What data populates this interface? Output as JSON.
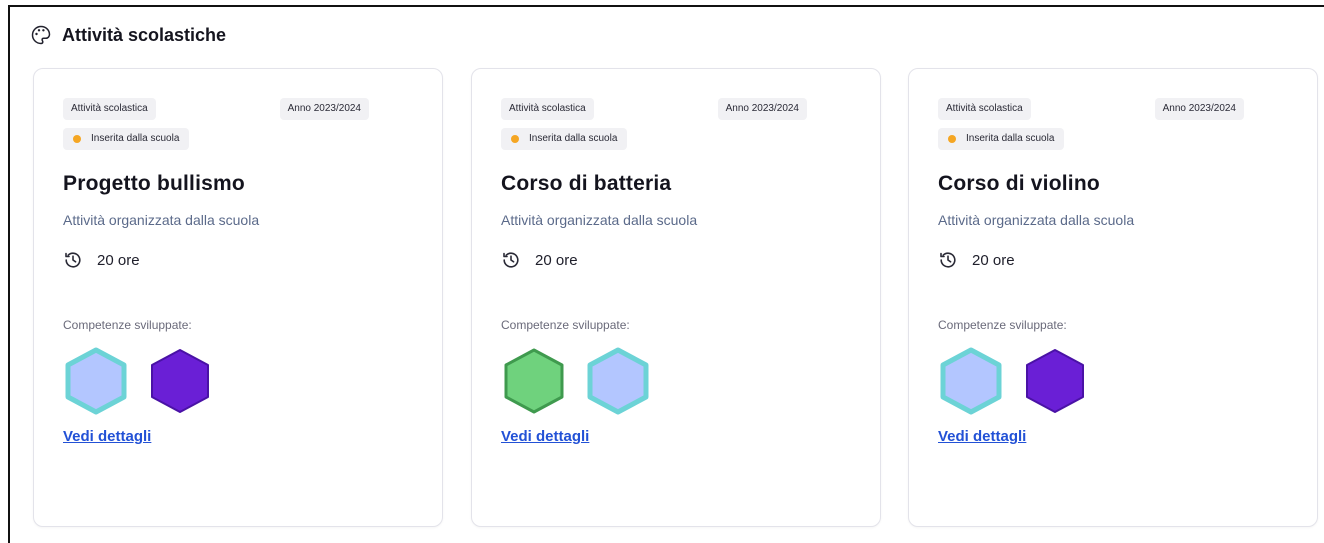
{
  "section": {
    "title": "Attività scolastiche",
    "icon": "palette-icon"
  },
  "cards": [
    {
      "type_tag": "Attività scolastica",
      "year_tag": "Anno 2023/2024",
      "status": "Inserita dalla scuola",
      "status_color": "#f5a623",
      "title": "Progetto bullismo",
      "subtitle": "Attività organizzata dalla scuola",
      "hours": "20 ore",
      "skills_label": "Competenze sviluppate:",
      "skills": [
        {
          "name": "skill-hexagon-light-blue",
          "fill": "#b3c6ff",
          "border": "#6cd3d6"
        },
        {
          "name": "skill-hexagon-purple",
          "fill": "#6a1fd6",
          "border": "#4a12a6"
        }
      ],
      "link": "Vedi dettagli"
    },
    {
      "type_tag": "Attività scolastica",
      "year_tag": "Anno 2023/2024",
      "status": "Inserita dalla scuola",
      "status_color": "#f5a623",
      "title": "Corso di batteria",
      "subtitle": "Attività organizzata dalla scuola",
      "hours": "20 ore",
      "skills_label": "Competenze sviluppate:",
      "skills": [
        {
          "name": "skill-hexagon-green",
          "fill": "#6fd27d",
          "border": "#3f9a4e"
        },
        {
          "name": "skill-hexagon-light-blue",
          "fill": "#b3c6ff",
          "border": "#6cd3d6"
        }
      ],
      "link": "Vedi dettagli"
    },
    {
      "type_tag": "Attività scolastica",
      "year_tag": "Anno 2023/2024",
      "status": "Inserita dalla scuola",
      "status_color": "#f5a623",
      "title": "Corso di violino",
      "subtitle": "Attività organizzata dalla scuola",
      "hours": "20 ore",
      "skills_label": "Competenze sviluppate:",
      "skills": [
        {
          "name": "skill-hexagon-light-blue",
          "fill": "#b3c6ff",
          "border": "#6cd3d6"
        },
        {
          "name": "skill-hexagon-purple",
          "fill": "#6a1fd6",
          "border": "#4a12a6"
        }
      ],
      "link": "Vedi dettagli"
    }
  ]
}
